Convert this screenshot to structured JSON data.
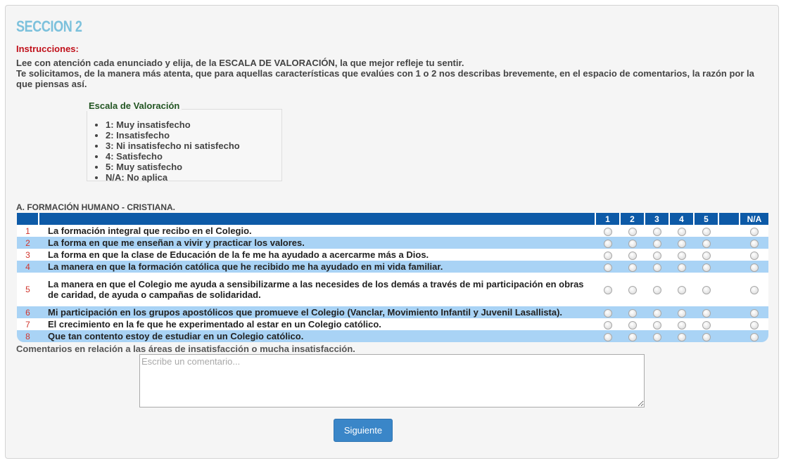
{
  "section": {
    "title": "SECCION 2",
    "instructions_label": "Instrucciones:",
    "instructions_line1": "Lee con atención cada enunciado y elija, de la ESCALA DE VALORACIÓN, la que mejor refleje tu sentir.",
    "instructions_line2": "Te solicitamos, de la manera más atenta, que para aquellas características que evalúes con 1 o 2 nos describas brevemente, en el espacio de comentarios, la razón por la que piensas así."
  },
  "scale": {
    "legend": "Escala de Valoración",
    "items": [
      "1: Muy insatisfecho",
      "2: Insatisfecho",
      "3: Ni insatisfecho ni satisfecho",
      "4: Satisfecho",
      "5: Muy satisfecho",
      "N/A: No aplica"
    ]
  },
  "table": {
    "title": "A. FORMACIÓN HUMANO - CRISTIANA.",
    "headers": {
      "h1": "1",
      "h2": "2",
      "h3": "3",
      "h4": "4",
      "h5": "5",
      "na": "N/A"
    },
    "rows": [
      {
        "num": "1",
        "text": "La formación integral que recibo en el Colegio."
      },
      {
        "num": "2",
        "text": "La forma en que me enseñan a vivir y practicar los valores."
      },
      {
        "num": "3",
        "text": "La forma en que la clase de Educación de la fe me ha ayudado a acercarme más a Dios."
      },
      {
        "num": "4",
        "text": "La manera en que la formación católica que he recibido me ha ayudado en mi vida familiar."
      },
      {
        "num": "5",
        "text": "La manera en que el Colegio me ayuda a sensibilizarme a las necesides de los demás a través de mi participación en obras de caridad, de ayuda o campañas de solidaridad."
      },
      {
        "num": "6",
        "text": "Mi participación en los grupos apostólicos que promueve el Colegio (Vanclar, Movimiento Infantil y Juvenil Lasallista)."
      },
      {
        "num": "7",
        "text": "El crecimiento en la fe que he experimentado al estar en un Colegio católico."
      },
      {
        "num": "8",
        "text": "Que tan contento estoy de estudiar en un Colegio católico."
      }
    ]
  },
  "comments": {
    "label": "Comentarios en relación a las áreas de insatisfacción o mucha insatisfacción.",
    "placeholder": "Escribe un comentario...",
    "value": ""
  },
  "next_button": {
    "label": "Siguiente"
  },
  "colors": {
    "title": "#7cc1dc",
    "instructions_label": "#c0101a",
    "header_bg": "#0d5aa7",
    "row_alt_bg": "#a9d3f5",
    "button_bg": "#3a86c8"
  }
}
